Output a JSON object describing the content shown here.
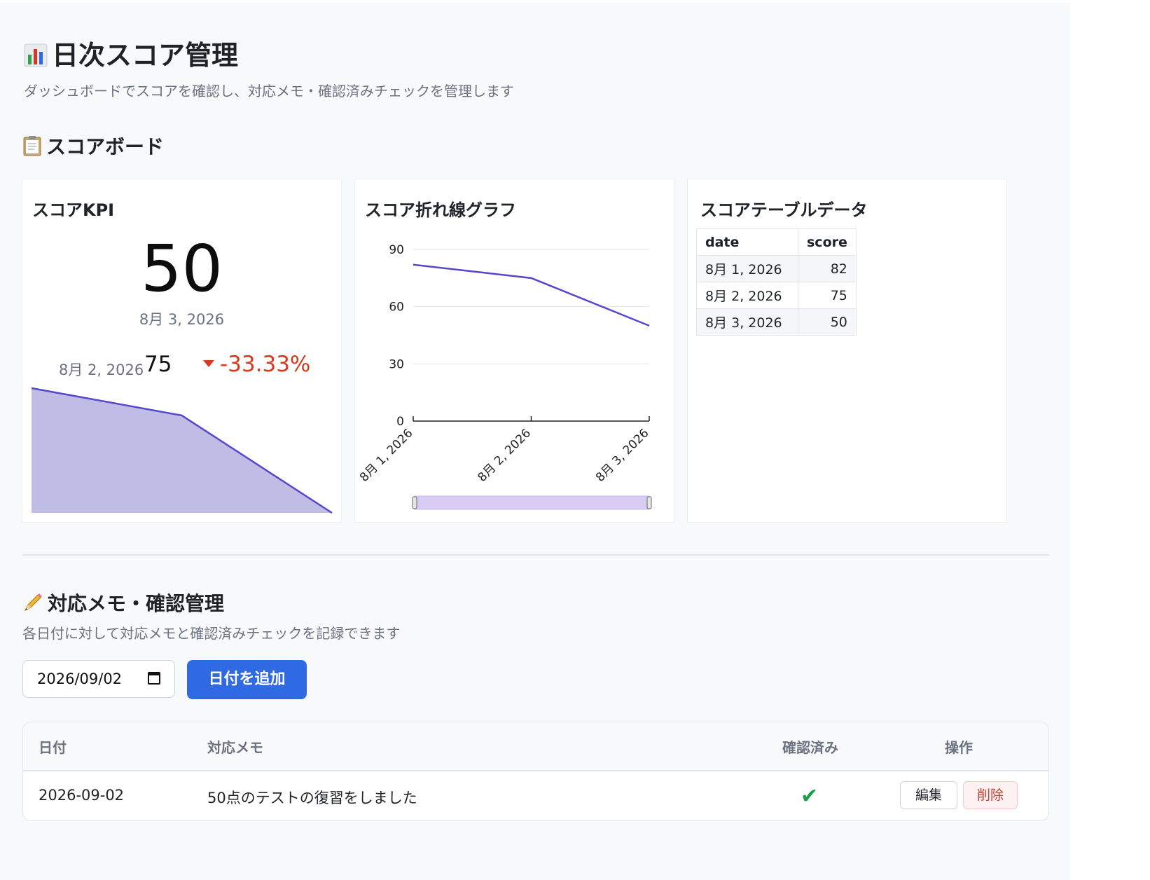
{
  "header": {
    "title_icon": "bar-chart-icon",
    "title": "日次スコア管理",
    "subtitle": "ダッシュボードでスコアを確認し、対応メモ・確認済みチェックを管理します"
  },
  "scoreboard": {
    "icon": "clipboard-icon",
    "heading": "スコアボード",
    "kpi": {
      "title": "スコアKPI",
      "value": "50",
      "date": "8月 3, 2026",
      "prev_date": "8月 2, 2026",
      "prev_value": "75",
      "delta": "-33.33%",
      "delta_direction": "down",
      "delta_color": "#d9381e",
      "sparkline": [
        82,
        75,
        50
      ]
    },
    "line_chart": {
      "title": "スコア折れ線グラフ"
    },
    "table": {
      "title": "スコアテーブルデータ",
      "columns": [
        "date",
        "score"
      ],
      "rows": [
        [
          "8月 1, 2026",
          "82"
        ],
        [
          "8月 2, 2026",
          "75"
        ],
        [
          "8月 3, 2026",
          "50"
        ]
      ]
    }
  },
  "chart_data": {
    "type": "line",
    "title": "スコア折れ線グラフ",
    "categories": [
      "8月 1, 2026",
      "8月 2, 2026",
      "8月 3, 2026"
    ],
    "series": [
      {
        "values": [
          82,
          75,
          50
        ],
        "color": "#5548c8"
      }
    ],
    "y_ticks": [
      0,
      30,
      60,
      90
    ],
    "ylim": [
      0,
      90
    ],
    "grid": true,
    "range_slider": true
  },
  "memo": {
    "icon": "pencil-icon",
    "heading": "対応メモ・確認管理",
    "description": "各日付に対して対応メモと確認済みチェックを記録できます",
    "date_input_value": "2026/09/02",
    "add_button": "日付を追加",
    "columns": {
      "date": "日付",
      "memo": "対応メモ",
      "checked": "確認済み",
      "actions": "操作"
    },
    "rows": [
      {
        "date": "2026-09-02",
        "memo": "50点のテストの復習をしました",
        "checked": true,
        "edit": "編集",
        "delete": "削除"
      }
    ]
  },
  "colors": {
    "accent": "#2f6ae4",
    "line": "#5548c8",
    "area": "#bfbce6",
    "check": "#1e9e4a",
    "danger": "#d0392f"
  }
}
